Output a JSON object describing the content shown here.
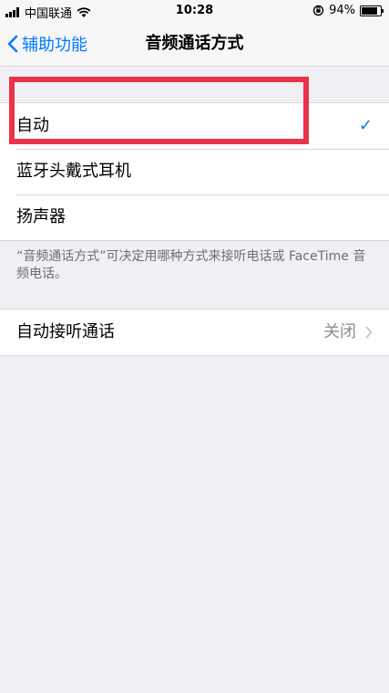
{
  "status_bar": {
    "carrier": "中国联通",
    "time": "10:28",
    "battery": "94%",
    "battery_level": 0.94
  },
  "nav": {
    "back_label": "辅助功能",
    "title": "音频通话方式"
  },
  "routing_options": [
    {
      "label": "自动",
      "selected": true
    },
    {
      "label": "蓝牙头戴式耳机",
      "selected": false
    },
    {
      "label": "扬声器",
      "selected": false
    }
  ],
  "checkmark": "✓",
  "footer_note": "“音频通话方式”可决定用哪种方式来接听电话或 FaceTime 音频电话。",
  "auto_answer": {
    "label": "自动接听通话",
    "value": "关闭"
  },
  "colors": {
    "accent": "#007aff",
    "highlight_box": "#e8334a",
    "background": "#efeff4"
  }
}
